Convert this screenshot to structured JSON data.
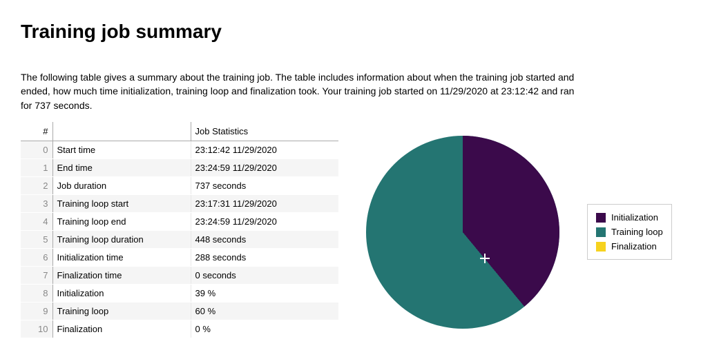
{
  "title": "Training job summary",
  "intro": "The following table gives a summary about the training job. The table includes information about when the training job started and ended, how much time initialization, training loop and finalization took. Your training job started on 11/29/2020 at 23:12:42 and ran for 737 seconds.",
  "table": {
    "headers": {
      "idx": "#",
      "label": "",
      "value": "Job Statistics"
    },
    "rows": [
      {
        "idx": "0",
        "label": "Start time",
        "value": "23:12:42 11/29/2020"
      },
      {
        "idx": "1",
        "label": "End time",
        "value": "23:24:59 11/29/2020"
      },
      {
        "idx": "2",
        "label": "Job duration",
        "value": "737 seconds"
      },
      {
        "idx": "3",
        "label": "Training loop start",
        "value": "23:17:31 11/29/2020"
      },
      {
        "idx": "4",
        "label": "Training loop end",
        "value": "23:24:59 11/29/2020"
      },
      {
        "idx": "5",
        "label": "Training loop duration",
        "value": "448 seconds"
      },
      {
        "idx": "6",
        "label": "Initialization time",
        "value": "288 seconds"
      },
      {
        "idx": "7",
        "label": "Finalization time",
        "value": "0 seconds"
      },
      {
        "idx": "8",
        "label": "Initialization",
        "value": "39 %"
      },
      {
        "idx": "9",
        "label": "Training loop",
        "value": "60 %"
      },
      {
        "idx": "10",
        "label": "Finalization",
        "value": "0 %"
      }
    ]
  },
  "legend": {
    "items": [
      {
        "name": "Initialization",
        "color": "#3b0a4b"
      },
      {
        "name": "Training loop",
        "color": "#247572"
      },
      {
        "name": "Finalization",
        "color": "#f6d21e"
      }
    ]
  },
  "chart_data": {
    "type": "pie",
    "title": "",
    "series": [
      {
        "name": "Initialization",
        "value": 39,
        "color": "#3b0a4b"
      },
      {
        "name": "Training loop",
        "value": 60,
        "color": "#247572"
      },
      {
        "name": "Finalization",
        "value": 0,
        "color": "#f6d21e"
      }
    ]
  }
}
